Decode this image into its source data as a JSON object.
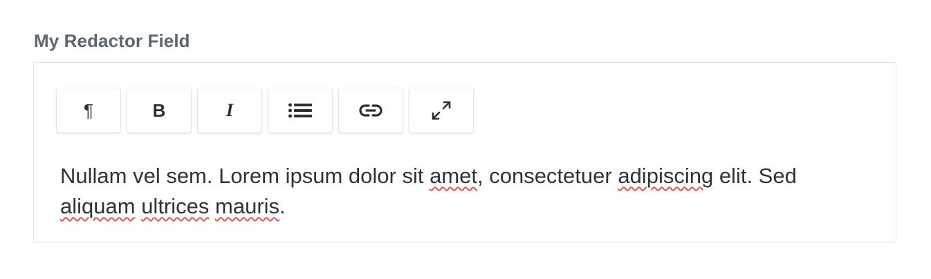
{
  "field": {
    "label": "My Redactor Field"
  },
  "toolbar": {
    "buttons": [
      {
        "name": "format",
        "glyph": "¶",
        "icon": "paragraph-icon"
      },
      {
        "name": "bold",
        "glyph": "B",
        "icon": "bold-icon"
      },
      {
        "name": "italic",
        "glyph": "I",
        "icon": "italic-icon"
      },
      {
        "name": "lists",
        "icon": "list-icon"
      },
      {
        "name": "link",
        "icon": "link-icon"
      },
      {
        "name": "fullscreen",
        "icon": "expand-icon"
      }
    ]
  },
  "content": {
    "seg1": "Nullam vel sem. Lorem ipsum dolor sit ",
    "w1": "amet",
    "seg2": ", consectetuer ",
    "w2": "adipiscing",
    "seg3": " elit. Sed ",
    "w3": "aliquam",
    "seg4": " ",
    "w4": "ultrices",
    "seg5": " ",
    "w5": "mauris",
    "seg6": "."
  },
  "colors": {
    "label": "#596673",
    "border": "#dfe3e7",
    "text": "#2f3338",
    "spellcheck": "#e2534b"
  }
}
